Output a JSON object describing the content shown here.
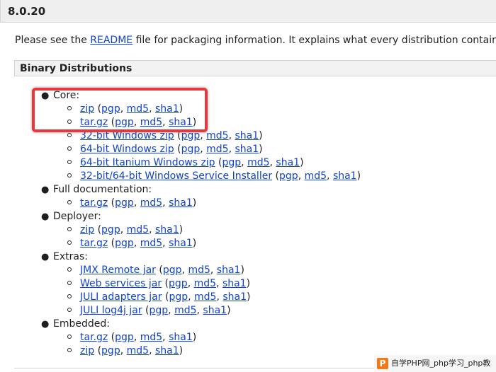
{
  "version": "8.0.20",
  "intro": {
    "before": "Please see the ",
    "link": "README",
    "after": " file for packaging information. It explains what every distribution contains."
  },
  "section_title": "Binary Distributions",
  "core": {
    "label": "Core:",
    "zip": "zip",
    "tar": "tar.gz",
    "win32": "32-bit Windows zip",
    "win64": "64-bit Windows zip",
    "itanium": "64-bit Itanium Windows zip",
    "installer": "32-bit/64-bit Windows Service Installer"
  },
  "fulldoc": {
    "label": "Full documentation:",
    "tar": "tar.gz"
  },
  "deployer": {
    "label": "Deployer:",
    "zip": "zip",
    "tar": "tar.gz"
  },
  "extras": {
    "label": "Extras:",
    "jmx": "JMX Remote jar",
    "ws": "Web services jar",
    "juli_adapters": "JULI adapters jar",
    "juli_log4j": "JULI log4j jar"
  },
  "embedded": {
    "label": "Embedded:",
    "tar": "tar.gz",
    "zip": "zip"
  },
  "sig": {
    "pgp": "pgp",
    "md5": "md5",
    "sha1": "sha1"
  },
  "watermark": {
    "logo": "P",
    "text": "自学PHP网_php学习_php教"
  },
  "colors": {
    "link": "#1144cc",
    "highlight": "#e8383b",
    "header_bg": "#efefef"
  }
}
